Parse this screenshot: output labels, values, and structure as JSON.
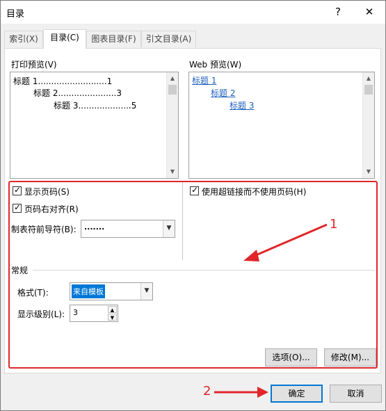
{
  "window": {
    "title": "目录",
    "help_glyph": "?",
    "close_glyph": "✕"
  },
  "tabs": [
    {
      "label": "索引(X)",
      "active": false
    },
    {
      "label": "目录(C)",
      "active": true
    },
    {
      "label": "图表目录(F)",
      "active": false
    },
    {
      "label": "引文目录(A)",
      "active": false
    }
  ],
  "print_preview": {
    "label": "打印预览(V)",
    "lines": [
      "标题 1..........................1",
      "标题 2......................3",
      "标题 3....................5"
    ]
  },
  "web_preview": {
    "label": "Web 预览(W)",
    "links": [
      "标题 1",
      "标题 2",
      "标题 3"
    ]
  },
  "options": {
    "show_page_numbers": {
      "label": "显示页码(S)",
      "checked": true
    },
    "right_align": {
      "label": "页码右对齐(R)",
      "checked": true
    },
    "tab_leader": {
      "label": "制表符前导符(B):",
      "value": "......."
    },
    "use_hyperlinks": {
      "label": "使用超链接而不使用页码(H)",
      "checked": true
    }
  },
  "general": {
    "heading": "常规",
    "format_label": "格式(T):",
    "format_value": "来自模板",
    "levels_label": "显示级别(L):",
    "levels_value": "3"
  },
  "buttons": {
    "options": "选项(O)...",
    "modify": "修改(M)...",
    "ok": "确定",
    "cancel": "取消"
  },
  "annotations": {
    "num1": "1",
    "num2": "2"
  },
  "glyphs": {
    "check": "✓",
    "arrow_down": "▼",
    "arrow_up": "▲"
  }
}
